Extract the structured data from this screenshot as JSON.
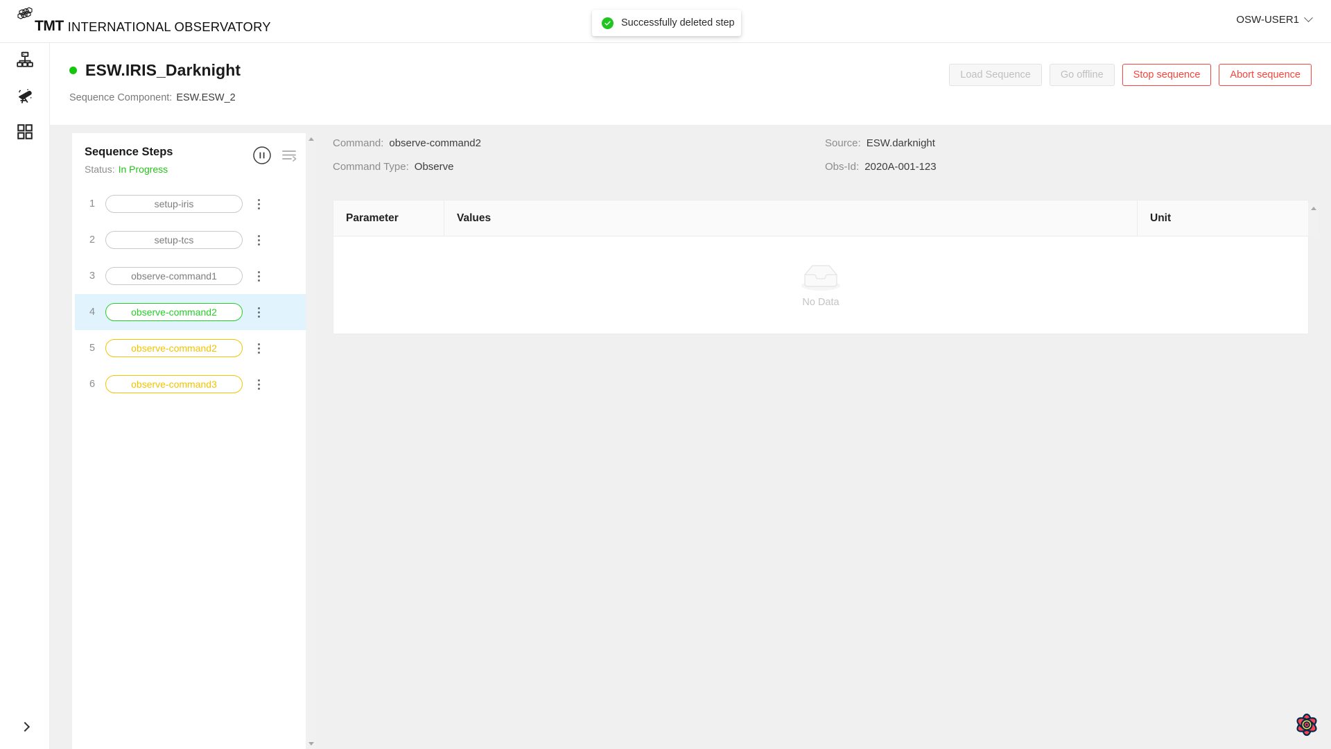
{
  "topbar": {
    "brand_mark": "TMT",
    "brand_name": "INTERNATIONAL OBSERVATORY",
    "logo_icon": "tmt-hex-mirror-logo",
    "user": "OSW-USER1",
    "user_chevron_icon": "chevron-down-icon"
  },
  "toast": {
    "message": "Successfully deleted step",
    "icon": "check-circle-icon",
    "color": "#20c520"
  },
  "rail": {
    "items": [
      {
        "name": "sitemap",
        "icon": "sitemap-icon"
      },
      {
        "name": "telescope",
        "icon": "telescope-icon"
      },
      {
        "name": "grid",
        "icon": "grid-icon"
      }
    ],
    "expand_icon": "chevron-right-icon"
  },
  "header": {
    "title": "ESW.IRIS_Darknight",
    "status_color": "#16c60c",
    "subtitle_label": "Sequence Component:",
    "subtitle_value": "ESW.ESW_2",
    "actions": [
      {
        "label": "Load Sequence",
        "state": "disabled"
      },
      {
        "label": "Go offline",
        "state": "disabled"
      },
      {
        "label": "Stop sequence",
        "state": "danger"
      },
      {
        "label": "Abort sequence",
        "state": "danger"
      }
    ]
  },
  "steps_panel": {
    "title": "Sequence Steps",
    "status_label": "Status:",
    "status_value": "In Progress",
    "status_color": "#22c417",
    "pause_icon": "pause-circle-icon",
    "reorder_icon": "reorder-list-icon",
    "steps": [
      {
        "num": "1",
        "label": "setup-iris",
        "state": "done"
      },
      {
        "num": "2",
        "label": "setup-tcs",
        "state": "done"
      },
      {
        "num": "3",
        "label": "observe-command1",
        "state": "done"
      },
      {
        "num": "4",
        "label": "observe-command2",
        "state": "running"
      },
      {
        "num": "5",
        "label": "observe-command2",
        "state": "pending"
      },
      {
        "num": "6",
        "label": "observe-command3",
        "state": "pending"
      }
    ],
    "colors": {
      "done": "#7d7d7d",
      "running": "#25cf26",
      "pending": "#f2c400",
      "selected_bg": "#e1f4fd",
      "selected_marker": "#3f51f5"
    }
  },
  "detail": {
    "command_label": "Command:",
    "command_value": "observe-command2",
    "command_type_label": "Command Type:",
    "command_type_value": "Observe",
    "source_label": "Source:",
    "source_value": "ESW.darknight",
    "obsid_label": "Obs-Id:",
    "obsid_value": "2020A-001-123",
    "table": {
      "columns": [
        "Parameter",
        "Values",
        "Unit"
      ],
      "rows": [],
      "empty_text": "No Data",
      "empty_icon": "empty-box-icon"
    }
  },
  "devtools": {
    "icon": "react-query-flower-icon"
  },
  "scrollbars": {
    "up_arrow_icon": "triangle-up-icon",
    "down_arrow_icon": "triangle-down-icon"
  }
}
